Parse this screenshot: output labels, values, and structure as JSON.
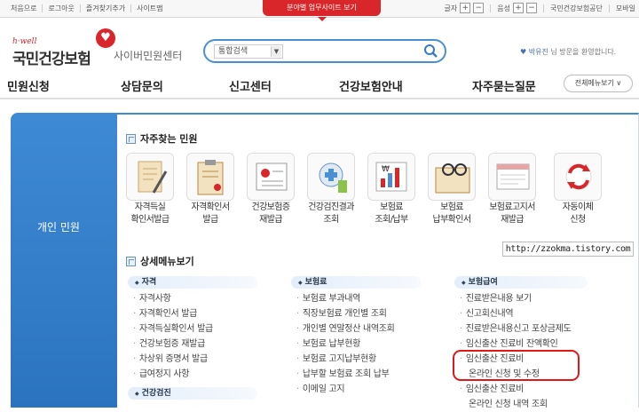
{
  "topbar": {
    "links": [
      "처음으로",
      "로그아웃",
      "즐겨찾기추가",
      "사이트맵"
    ],
    "dept_tab": "분야별 업무사이트 보기",
    "font_label": "글자",
    "sound_label": "음성",
    "plus": "+",
    "minus": "−",
    "right_links": [
      "국민건강보험공단",
      "모바일"
    ]
  },
  "header": {
    "logo_sub": "h·well",
    "logo_name": "국민건강보험",
    "logo_center": "사이버민원센터",
    "search_select": "통합검색",
    "welcome_name": "박유진",
    "welcome_suffix": " 님 방문을 환영합니다."
  },
  "gnb": {
    "items": [
      "민원신청",
      "상담문의",
      "신고센터",
      "건강보험안내",
      "자주묻는질문"
    ],
    "all_menu": "전체메뉴보기 ∨"
  },
  "left": {
    "title": "개인 민원"
  },
  "favorites": {
    "title": "자주찾는 민원",
    "items": [
      {
        "l1": "자격득실",
        "l2": "확인서발급",
        "icon": "document-pen-icon"
      },
      {
        "l1": "자격확인서",
        "l2": "발급",
        "icon": "clipboard-icon"
      },
      {
        "l1": "건강보험증",
        "l2": "재발급",
        "icon": "insurance-card-icon"
      },
      {
        "l1": "건강검진결과",
        "l2": "조회",
        "icon": "medical-checkup-icon"
      },
      {
        "l1": "보험료",
        "l2": "조회/납부",
        "icon": "won-chart-icon"
      },
      {
        "l1": "보험료",
        "l2": "납부확인서",
        "icon": "glasses-paper-icon"
      },
      {
        "l1": "보험료고지서",
        "l2": "재발급",
        "icon": "bill-icon"
      },
      {
        "l1": "자동이체",
        "l2": "신청",
        "icon": "auto-transfer-icon"
      }
    ]
  },
  "details": {
    "title": "상세메뉴보기",
    "columns": [
      {
        "head": "자격",
        "items": [
          "자격사항",
          "자격확인서 발급",
          "자격득실확인서 발급",
          "건강보험증 재발급",
          "차상위 증명서 발급",
          "급여정지 사항"
        ]
      },
      {
        "head": "보험료",
        "items": [
          "보험료 부과내역",
          "직장보험료 개인별 조회",
          "개인별 연말정산 내역조회",
          "보험료 납부현황",
          "보험료 고지납부현황",
          "납부할 보험료 조회 납부",
          "이메일 고지"
        ]
      },
      {
        "head": "보험급여",
        "items": [
          "진료받은내용 보기",
          "신고회신내역",
          "진료받은내용신고 포상금제도",
          "임신출산 진료비 잔액확인",
          "임신출산 진료비",
          "온라인 신청 및 수정",
          "임신출산 진료비",
          "온라인 신청 내역 조회"
        ]
      }
    ],
    "next_head": "건강검진"
  },
  "watermark": "http://zzokma.tistory.com",
  "colors": {
    "brand_red": "#d9262b",
    "brand_blue": "#3f8ad4",
    "annotation_red": "#e01818"
  }
}
